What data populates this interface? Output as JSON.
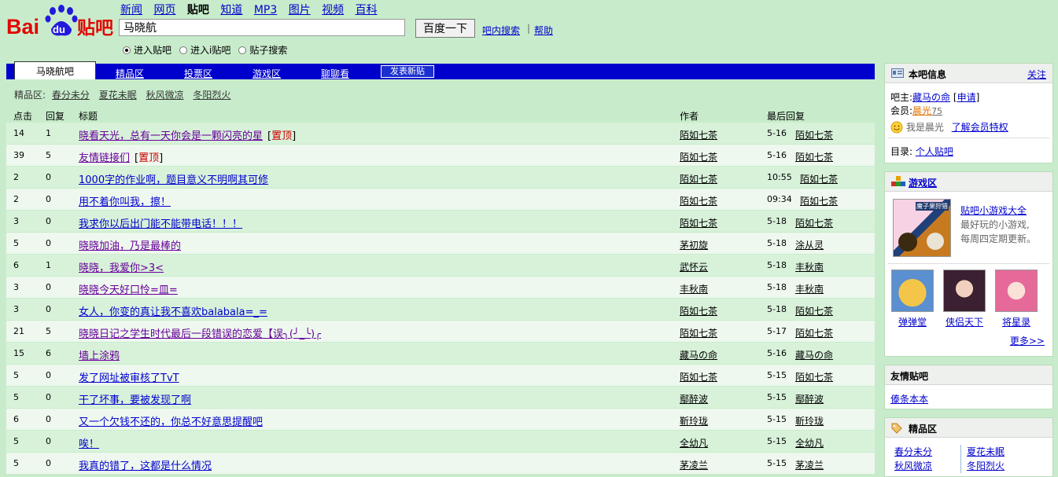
{
  "logo": {
    "text": "Bai",
    "paw": "du",
    "suffix": "贴吧"
  },
  "top_nav": [
    "新闻",
    "网页",
    "贴吧",
    "知道",
    "MP3",
    "图片",
    "视频",
    "百科"
  ],
  "search": {
    "value": "马晓航",
    "button": "百度一下",
    "in_bar_search": "吧内搜索",
    "separator": "|",
    "help": "帮助",
    "radios": [
      {
        "label": "进入贴吧",
        "checked": true
      },
      {
        "label": "进入i贴吧",
        "checked": false
      },
      {
        "label": "贴子搜索",
        "checked": false
      }
    ]
  },
  "tabs": {
    "active": "马晓航吧",
    "items": [
      "精品区",
      "投票区",
      "游戏区",
      "聊聊看"
    ],
    "new_post": "发表新贴"
  },
  "featured": {
    "label": "精品区:",
    "items": [
      "春分未分",
      "夏花未眠",
      "秋风微凉",
      "冬阳烈火"
    ]
  },
  "table": {
    "headers": {
      "clicks": "点击",
      "replies": "回复",
      "title": "标题",
      "author": "作者",
      "last_reply": "最后回复"
    },
    "rows": [
      {
        "clicks": "14",
        "replies": "1",
        "title": "晓看天光，总有一天你会是一颗闪亮的星",
        "badge": "置顶",
        "author": "陌如七茶",
        "time": "5-16",
        "last": "陌如七茶",
        "visited": true
      },
      {
        "clicks": "39",
        "replies": "5",
        "title": "友情链接们",
        "badge": "置顶",
        "author": "陌如七茶",
        "time": "5-16",
        "last": "陌如七茶",
        "visited": true
      },
      {
        "clicks": "2",
        "replies": "0",
        "title": "1000字的作业啊，题目意义不明啊其可修",
        "badge": "",
        "author": "陌如七茶",
        "time": "10:55",
        "last": "陌如七茶",
        "visited": false
      },
      {
        "clicks": "2",
        "replies": "0",
        "title": "用不着你叫我，擦！",
        "badge": "",
        "author": "陌如七茶",
        "time": "09:34",
        "last": "陌如七茶",
        "visited": false
      },
      {
        "clicks": "3",
        "replies": "0",
        "title": "我求你以后出门能不能带电话！！！",
        "badge": "",
        "author": "陌如七茶",
        "time": "5-18",
        "last": "陌如七茶",
        "visited": false
      },
      {
        "clicks": "5",
        "replies": "0",
        "title": "晓晓加油，乃是最棒的",
        "badge": "",
        "author": "茅初旋",
        "time": "5-18",
        "last": "涂从灵",
        "visited": true
      },
      {
        "clicks": "6",
        "replies": "1",
        "title": "晓晓，我爱你>3<",
        "badge": "",
        "author": "武怀云",
        "time": "5-18",
        "last": "丰秋南",
        "visited": true
      },
      {
        "clicks": "3",
        "replies": "0",
        "title": "晓晓今天好口怜=皿=",
        "badge": "",
        "author": "丰秋南",
        "time": "5-18",
        "last": "丰秋南",
        "visited": true
      },
      {
        "clicks": "3",
        "replies": "0",
        "title": "女人，你变的真让我不喜欢balabala=_=",
        "badge": "",
        "author": "陌如七茶",
        "time": "5-18",
        "last": "陌如七茶",
        "visited": false
      },
      {
        "clicks": "21",
        "replies": "5",
        "title": "晓晓日记之学生时代最后一段错误的恋爱【误╮(╯_╰)╭",
        "badge": "",
        "author": "陌如七茶",
        "time": "5-17",
        "last": "陌如七茶",
        "visited": true
      },
      {
        "clicks": "15",
        "replies": "6",
        "title": "墙上涂鸦",
        "badge": "",
        "author": "藏马の命",
        "time": "5-16",
        "last": "藏马の命",
        "visited": true
      },
      {
        "clicks": "5",
        "replies": "0",
        "title": "发了网址被审核了TvT",
        "badge": "",
        "author": "陌如七茶",
        "time": "5-15",
        "last": "陌如七茶",
        "visited": false
      },
      {
        "clicks": "5",
        "replies": "0",
        "title": "干了坏事，要被发现了啊",
        "badge": "",
        "author": "鄢醉波",
        "time": "5-15",
        "last": "鄢醉波",
        "visited": false
      },
      {
        "clicks": "6",
        "replies": "0",
        "title": "又一个欠钱不还的，你总不好意思提醒吧",
        "badge": "",
        "author": "靳玲珑",
        "time": "5-15",
        "last": "靳玲珑",
        "visited": false
      },
      {
        "clicks": "5",
        "replies": "0",
        "title": "唉！",
        "badge": "",
        "author": "全幼凡",
        "time": "5-15",
        "last": "全幼凡",
        "visited": false
      },
      {
        "clicks": "5",
        "replies": "0",
        "title": "我真的错了，这都是什么情况",
        "badge": "",
        "author": "茅凌兰",
        "time": "5-15",
        "last": "茅凌兰",
        "visited": false
      }
    ]
  },
  "sidebar": {
    "info": {
      "title": "本吧信息",
      "follow": "关注",
      "owner_label": "吧主:",
      "owner": "藏马の命",
      "apply": "申请",
      "member_label": "会员:",
      "member_name": "晨光",
      "member_count": "75",
      "i_am": "我是晨光",
      "learn_more": "了解会员特权",
      "dir_label": "目录:",
      "dir": "个人贴吧"
    },
    "games": {
      "title": "游戏区",
      "feature_title": "贴吧小游戏大全",
      "feature_desc1": "最好玩的小游戏,",
      "feature_desc2": "每周四定期更新。",
      "feature_thumb_caption": "魔子果狩猎",
      "items": [
        "弹弹堂",
        "侠侣天下",
        "将星录"
      ],
      "more": "更多>>"
    },
    "friends": {
      "title": "友情贴吧",
      "link": "傣条本本"
    },
    "featured": {
      "title": "精品区",
      "items": [
        "春分未分",
        "夏花未眠",
        "秋风微凉",
        "冬阳烈火"
      ]
    }
  },
  "colors": {
    "background": "#c8eccb",
    "tabbar": "#0000cc",
    "link": "#0000cc",
    "visited": "#660099",
    "badge": "#cc0000"
  }
}
